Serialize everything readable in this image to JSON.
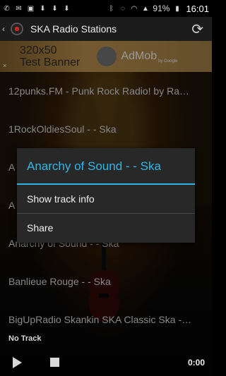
{
  "status_bar": {
    "battery": "91%",
    "time": "16:01",
    "icons": [
      "phone-icon",
      "gmail-icon",
      "download-icon",
      "sync-icon",
      "bluetooth-icon",
      "wifi-icon",
      "signal-icon",
      "battery-icon"
    ]
  },
  "action_bar": {
    "title": "SKA Radio Stations",
    "refresh_icon": "refresh-icon"
  },
  "ad": {
    "line1": "320x50",
    "line2": "Test Banner",
    "brand": "AdMob",
    "by": "by Google",
    "close": "×"
  },
  "stations": [
    "12punks.FM - Punk Rock Radio! by Ra…",
    "1RockOldiesSoul - - Ska",
    "A",
    "A",
    "Anarchy of Sound - - Ska",
    "Banlieue Rouge - - Ska",
    "BigUpRadio Skankin SKA Classic Ska -…"
  ],
  "dialog": {
    "title": "Anarchy of Sound - - Ska",
    "items": [
      "Show track info",
      "Share"
    ]
  },
  "player": {
    "now_playing": "No Track",
    "time": "0:00"
  },
  "colors": {
    "accent": "#33b5e5",
    "dialog_bg": "#282828",
    "actionbar_bg": "#1c1c1c"
  }
}
